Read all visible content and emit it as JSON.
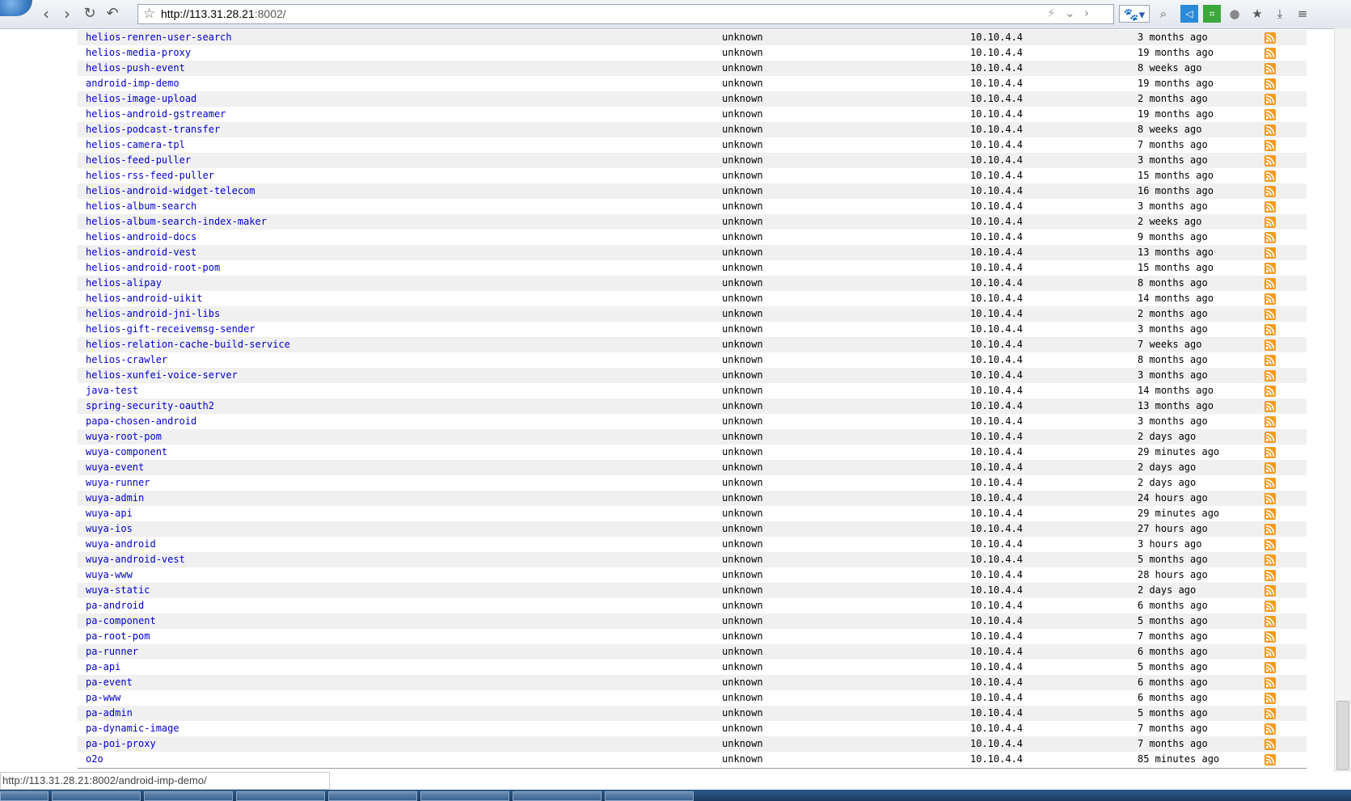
{
  "browser": {
    "url_host": "http://113.31.28.21",
    "url_port": ":8002/",
    "status_url": "http://113.31.28.21:8002/android-imp-demo/"
  },
  "repos": [
    {
      "name": "helios-renren-user-search",
      "desc": "unknown",
      "owner": "10.10.4.4",
      "time": "3 months ago"
    },
    {
      "name": "helios-media-proxy",
      "desc": "unknown",
      "owner": "10.10.4.4",
      "time": "19 months ago"
    },
    {
      "name": "helios-push-event",
      "desc": "unknown",
      "owner": "10.10.4.4",
      "time": "8 weeks ago"
    },
    {
      "name": "android-imp-demo",
      "desc": "unknown",
      "owner": "10.10.4.4",
      "time": "19 months ago"
    },
    {
      "name": "helios-image-upload",
      "desc": "unknown",
      "owner": "10.10.4.4",
      "time": "2 months ago"
    },
    {
      "name": "helios-android-gstreamer",
      "desc": "unknown",
      "owner": "10.10.4.4",
      "time": "19 months ago"
    },
    {
      "name": "helios-podcast-transfer",
      "desc": "unknown",
      "owner": "10.10.4.4",
      "time": "8 weeks ago"
    },
    {
      "name": "helios-camera-tpl",
      "desc": "unknown",
      "owner": "10.10.4.4",
      "time": "7 months ago"
    },
    {
      "name": "helios-feed-puller",
      "desc": "unknown",
      "owner": "10.10.4.4",
      "time": "3 months ago"
    },
    {
      "name": "helios-rss-feed-puller",
      "desc": "unknown",
      "owner": "10.10.4.4",
      "time": "15 months ago"
    },
    {
      "name": "helios-android-widget-telecom",
      "desc": "unknown",
      "owner": "10.10.4.4",
      "time": "16 months ago"
    },
    {
      "name": "helios-album-search",
      "desc": "unknown",
      "owner": "10.10.4.4",
      "time": "3 months ago"
    },
    {
      "name": "helios-album-search-index-maker",
      "desc": "unknown",
      "owner": "10.10.4.4",
      "time": "2 weeks ago"
    },
    {
      "name": "helios-android-docs",
      "desc": "unknown",
      "owner": "10.10.4.4",
      "time": "9 months ago"
    },
    {
      "name": "helios-android-vest",
      "desc": "unknown",
      "owner": "10.10.4.4",
      "time": "13 months ago"
    },
    {
      "name": "helios-android-root-pom",
      "desc": "unknown",
      "owner": "10.10.4.4",
      "time": "15 months ago"
    },
    {
      "name": "helios-alipay",
      "desc": "unknown",
      "owner": "10.10.4.4",
      "time": "8 months ago"
    },
    {
      "name": "helios-android-uikit",
      "desc": "unknown",
      "owner": "10.10.4.4",
      "time": "14 months ago"
    },
    {
      "name": "helios-android-jni-libs",
      "desc": "unknown",
      "owner": "10.10.4.4",
      "time": "2 months ago"
    },
    {
      "name": "helios-gift-receivemsg-sender",
      "desc": "unknown",
      "owner": "10.10.4.4",
      "time": "3 months ago"
    },
    {
      "name": "helios-relation-cache-build-service",
      "desc": "unknown",
      "owner": "10.10.4.4",
      "time": "7 weeks ago"
    },
    {
      "name": "helios-crawler",
      "desc": "unknown",
      "owner": "10.10.4.4",
      "time": "8 months ago"
    },
    {
      "name": "helios-xunfei-voice-server",
      "desc": "unknown",
      "owner": "10.10.4.4",
      "time": "3 months ago"
    },
    {
      "name": "java-test",
      "desc": "unknown",
      "owner": "10.10.4.4",
      "time": "14 months ago"
    },
    {
      "name": "spring-security-oauth2",
      "desc": "unknown",
      "owner": "10.10.4.4",
      "time": "13 months ago"
    },
    {
      "name": "papa-chosen-android",
      "desc": "unknown",
      "owner": "10.10.4.4",
      "time": "3 months ago"
    },
    {
      "name": "wuya-root-pom",
      "desc": "unknown",
      "owner": "10.10.4.4",
      "time": "2 days ago"
    },
    {
      "name": "wuya-component",
      "desc": "unknown",
      "owner": "10.10.4.4",
      "time": "29 minutes ago"
    },
    {
      "name": "wuya-event",
      "desc": "unknown",
      "owner": "10.10.4.4",
      "time": "2 days ago"
    },
    {
      "name": "wuya-runner",
      "desc": "unknown",
      "owner": "10.10.4.4",
      "time": "2 days ago"
    },
    {
      "name": "wuya-admin",
      "desc": "unknown",
      "owner": "10.10.4.4",
      "time": "24 hours ago"
    },
    {
      "name": "wuya-api",
      "desc": "unknown",
      "owner": "10.10.4.4",
      "time": "29 minutes ago"
    },
    {
      "name": "wuya-ios",
      "desc": "unknown",
      "owner": "10.10.4.4",
      "time": "27 hours ago"
    },
    {
      "name": "wuya-android",
      "desc": "unknown",
      "owner": "10.10.4.4",
      "time": "3 hours ago"
    },
    {
      "name": "wuya-android-vest",
      "desc": "unknown",
      "owner": "10.10.4.4",
      "time": "5 months ago"
    },
    {
      "name": "wuya-www",
      "desc": "unknown",
      "owner": "10.10.4.4",
      "time": "28 hours ago"
    },
    {
      "name": "wuya-static",
      "desc": "unknown",
      "owner": "10.10.4.4",
      "time": "2 days ago"
    },
    {
      "name": "pa-android",
      "desc": "unknown",
      "owner": "10.10.4.4",
      "time": "6 months ago"
    },
    {
      "name": "pa-component",
      "desc": "unknown",
      "owner": "10.10.4.4",
      "time": "5 months ago"
    },
    {
      "name": "pa-root-pom",
      "desc": "unknown",
      "owner": "10.10.4.4",
      "time": "7 months ago"
    },
    {
      "name": "pa-runner",
      "desc": "unknown",
      "owner": "10.10.4.4",
      "time": "6 months ago"
    },
    {
      "name": "pa-api",
      "desc": "unknown",
      "owner": "10.10.4.4",
      "time": "5 months ago"
    },
    {
      "name": "pa-event",
      "desc": "unknown",
      "owner": "10.10.4.4",
      "time": "6 months ago"
    },
    {
      "name": "pa-www",
      "desc": "unknown",
      "owner": "10.10.4.4",
      "time": "6 months ago"
    },
    {
      "name": "pa-admin",
      "desc": "unknown",
      "owner": "10.10.4.4",
      "time": "5 months ago"
    },
    {
      "name": "pa-dynamic-image",
      "desc": "unknown",
      "owner": "10.10.4.4",
      "time": "7 months ago"
    },
    {
      "name": "pa-poi-proxy",
      "desc": "unknown",
      "owner": "10.10.4.4",
      "time": "7 months ago"
    },
    {
      "name": "o2o",
      "desc": "unknown",
      "owner": "10.10.4.4",
      "time": "85 minutes ago"
    }
  ],
  "colors": {
    "link": "#0000cc",
    "rss": "#f49a21",
    "row_alt": "#f0f0f0"
  }
}
